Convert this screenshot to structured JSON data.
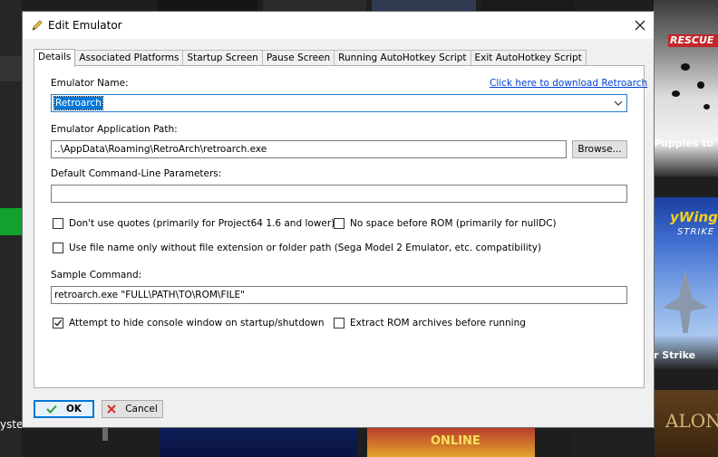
{
  "background": {
    "left_label": "ysteri",
    "card_101_caption": "Puppies to the",
    "card_101_title": "RESCUE",
    "card_sky_logo": "yWings",
    "card_sky_logo2": "STRIKE",
    "card_sky_caption": "r Strike",
    "card_bottom_text": "ONLINE",
    "card_right_text": "ALONE"
  },
  "dialog": {
    "title": "Edit Emulator",
    "tabs": [
      {
        "label": "Details",
        "active": true
      },
      {
        "label": "Associated Platforms",
        "active": false
      },
      {
        "label": "Startup Screen",
        "active": false
      },
      {
        "label": "Pause Screen",
        "active": false
      },
      {
        "label": "Running AutoHotkey Script",
        "active": false
      },
      {
        "label": "Exit AutoHotkey Script",
        "active": false
      }
    ],
    "emulator_name_label": "Emulator Name:",
    "download_link": "Click here to download Retroarch",
    "emulator_name_value": "Retroarch",
    "app_path_label": "Emulator Application Path:",
    "app_path_value": "..\\AppData\\Roaming\\RetroArch\\retroarch.exe",
    "browse_label": "Browse...",
    "cmd_params_label": "Default Command-Line Parameters:",
    "cmd_params_value": "",
    "checkbox_no_quotes": {
      "label": "Don't use quotes (primarily for Project64 1.6 and lower)",
      "checked": false
    },
    "checkbox_no_space": {
      "label": "No space before ROM (primarily for nullDC)",
      "checked": false
    },
    "checkbox_filename_only": {
      "label": "Use file name only without file extension or folder path (Sega Model 2 Emulator, etc. compatibility)",
      "checked": false
    },
    "sample_command_label": "Sample Command:",
    "sample_command_value": "retroarch.exe \"FULL\\PATH\\TO\\ROM\\FILE\"",
    "checkbox_hide_console": {
      "label": "Attempt to hide console window on startup/shutdown",
      "checked": true
    },
    "checkbox_extract_rom": {
      "label": "Extract ROM archives before running",
      "checked": false
    },
    "ok_label": "OK",
    "cancel_label": "Cancel"
  },
  "colors": {
    "accent": "#0078d7",
    "link": "#0040d0",
    "ok_check": "#2f9e3a",
    "cancel_x": "#d0312d",
    "background_green": "#11a12c"
  },
  "icons": {
    "title": "pencil-icon",
    "close": "close-icon",
    "dropdown": "chevron-down-icon",
    "ok": "checkmark-icon",
    "cancel": "x-icon"
  }
}
